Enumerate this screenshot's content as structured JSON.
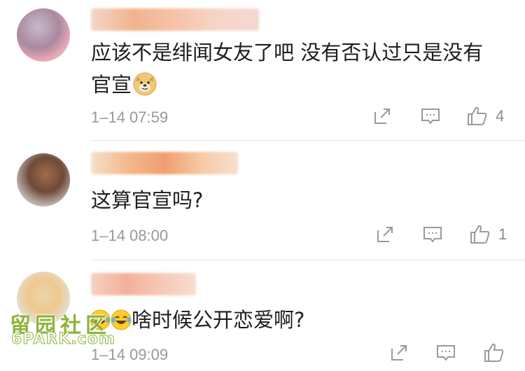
{
  "comments": [
    {
      "text": "应该不是绯闻女友了吧  没有否认过只是没有",
      "text_line2": "官宣",
      "time": "1–14 07:59",
      "likes": "4"
    },
    {
      "text": "这算官宣吗?",
      "time": "1–14 08:00",
      "likes": "1"
    },
    {
      "text": "啥时候公开恋爱啊?",
      "time": "1–14 09:09",
      "likes": ""
    }
  ],
  "watermark": {
    "cn": "留园社区",
    "en": "6PARK.com"
  },
  "icons": {
    "share": "share-icon",
    "reply": "comment-icon",
    "like": "thumbs-up-icon",
    "doge": "doge-emoji",
    "laugh": "laugh-cry-emoji"
  }
}
